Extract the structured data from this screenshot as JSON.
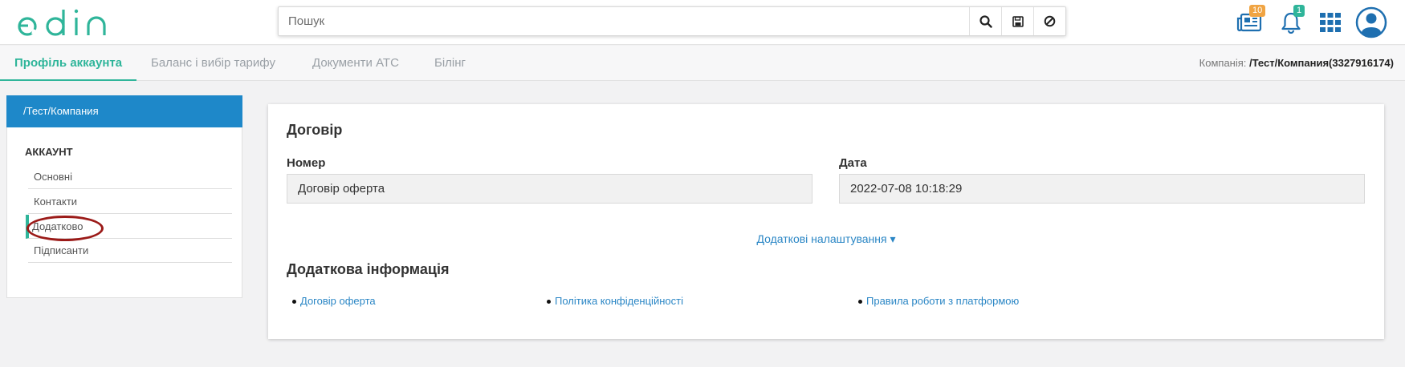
{
  "header": {
    "logo_text": "edin",
    "search": {
      "placeholder": "Пошук"
    },
    "icons": [
      "search-icon",
      "save-icon",
      "cancel-icon",
      "news-icon",
      "bell-icon",
      "apps-grid-icon",
      "user-avatar-icon"
    ],
    "news_badge": "10",
    "notifications_badge": "1"
  },
  "tabs": [
    {
      "label": "Профіль аккаунта",
      "active": true
    },
    {
      "label": "Баланс і вибір тарифу"
    },
    {
      "label": "Документи АТС"
    },
    {
      "label": "Білінг"
    }
  ],
  "company": {
    "label": "Компанія:",
    "value": "/Тест/Компания(3327916174)"
  },
  "sidebar": {
    "header": "/Тест/Компания",
    "section": "АККАУНТ",
    "items": [
      {
        "label": "Основні"
      },
      {
        "label": "Контакти"
      },
      {
        "label": "Додатково",
        "active": true
      },
      {
        "label": "Підписанти"
      }
    ]
  },
  "contract": {
    "title": "Договір",
    "number_label": "Номер",
    "number_value": "Договір оферта",
    "date_label": "Дата",
    "date_value": "2022-07-08 10:18:29",
    "more_settings": "Додаткові налаштування ▾"
  },
  "additional": {
    "title": "Додаткова інформація",
    "links": [
      "Договір оферта",
      "Політика конфіденційності",
      "Правила роботи з платформою"
    ]
  },
  "colors": {
    "accent": "#2fb59a",
    "primary_blue": "#1e88c9",
    "link": "#2a86c5",
    "annotation": "#9b1a18"
  }
}
